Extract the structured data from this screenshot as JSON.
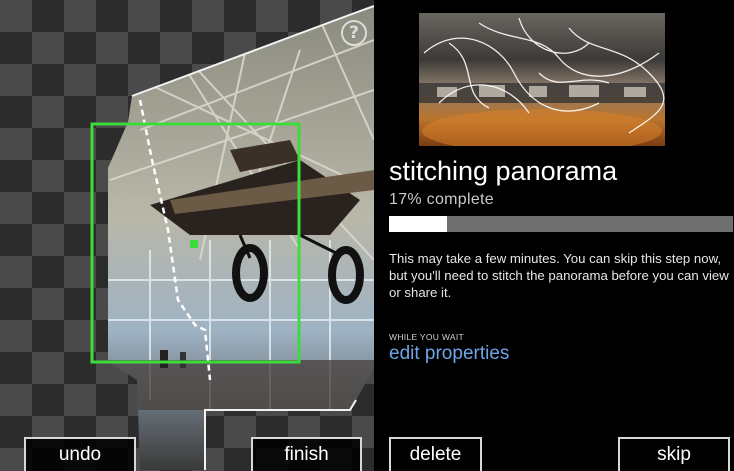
{
  "capture": {
    "help_label": "?",
    "undo_label": "undo",
    "finish_label": "finish"
  },
  "panel": {
    "title": "stitching panorama",
    "progress_text": "17% complete",
    "progress_fraction": 0.17,
    "info_text": "This may take a few minutes. You can skip this step now, but you'll need to stitch the panorama before you can view or share it.",
    "wait_label": "WHILE YOU WAIT",
    "edit_link": "edit properties",
    "delete_label": "delete",
    "skip_label": "skip"
  },
  "colors": {
    "target_frame": "#3ddc3d",
    "link": "#6fa6e6",
    "progress_track": "#6f6f6f",
    "progress_fill": "#ffffff"
  },
  "icons": [
    "help-icon"
  ]
}
